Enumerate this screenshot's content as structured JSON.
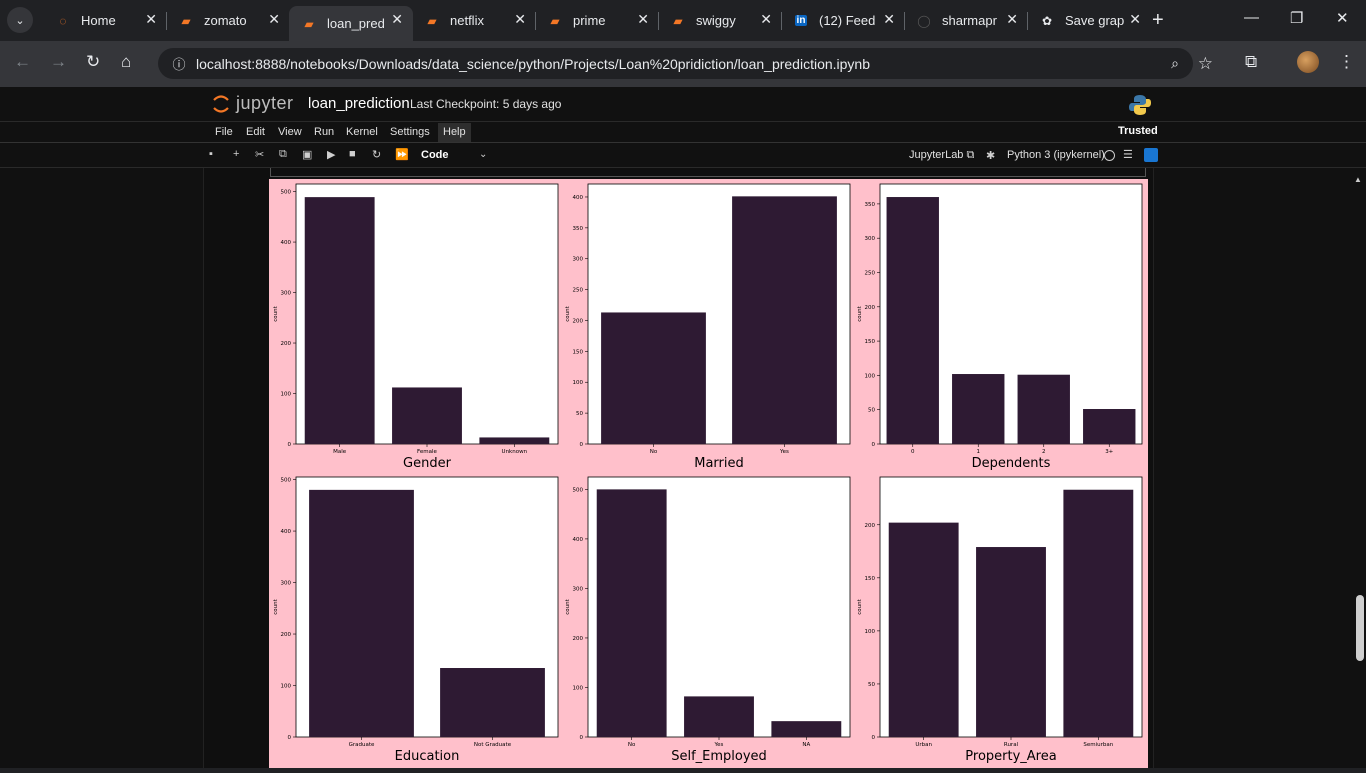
{
  "browser": {
    "tabs": [
      {
        "label": "Home",
        "icon": "jupyter-icon"
      },
      {
        "label": "zomato",
        "icon": "notebook-icon"
      },
      {
        "label": "loan_pred",
        "icon": "notebook-icon",
        "active": true
      },
      {
        "label": "netflix",
        "icon": "notebook-icon"
      },
      {
        "label": "prime",
        "icon": "notebook-icon"
      },
      {
        "label": "swiggy",
        "icon": "notebook-icon"
      },
      {
        "label": "(12) Feed",
        "icon": "linkedin-icon"
      },
      {
        "label": "sharmapr",
        "icon": "github-icon"
      },
      {
        "label": "Save grap",
        "icon": "chatgpt-icon"
      }
    ],
    "url": "localhost:8888/notebooks/Downloads/data_science/python/Projects/Loan%20pridiction/loan_prediction.ipynb"
  },
  "jupyter": {
    "brand": "jupyter",
    "notebook_name": "loan_prediction",
    "checkpoint": "Last Checkpoint: 5 days ago",
    "menu": [
      "File",
      "Edit",
      "View",
      "Run",
      "Kernel",
      "Settings",
      "Help"
    ],
    "trusted": "Trusted",
    "cell_type": "Code",
    "jupyterlab_label": "JupyterLab",
    "kernel_label": "Python 3 (ipykernel)"
  },
  "colors": {
    "figure_bg": "#ffc0cb",
    "bar": "#2e1a33",
    "accent": "#1976d2"
  },
  "chart_data": [
    {
      "type": "bar",
      "xlabel": "Gender",
      "ylabel": "count",
      "categories": [
        "Male",
        "Female",
        "Unknown"
      ],
      "values": [
        489,
        112,
        13
      ],
      "ylim": [
        0,
        515
      ],
      "yticks": [
        0,
        100,
        200,
        300,
        400,
        500
      ]
    },
    {
      "type": "bar",
      "xlabel": "Married",
      "ylabel": "count",
      "categories": [
        "No",
        "Yes"
      ],
      "values": [
        213,
        401
      ],
      "ylim": [
        0,
        421
      ],
      "yticks": [
        0,
        50,
        100,
        150,
        200,
        250,
        300,
        350,
        400
      ]
    },
    {
      "type": "bar",
      "xlabel": "Dependents",
      "ylabel": "count",
      "categories": [
        "0",
        "1",
        "2",
        "3+"
      ],
      "values": [
        360,
        102,
        101,
        51
      ],
      "ylim": [
        0,
        379
      ],
      "yticks": [
        0,
        50,
        100,
        150,
        200,
        250,
        300,
        350
      ]
    },
    {
      "type": "bar",
      "xlabel": "Education",
      "ylabel": "count",
      "categories": [
        "Graduate",
        "Not Graduate"
      ],
      "values": [
        480,
        134
      ],
      "ylim": [
        0,
        505
      ],
      "yticks": [
        0,
        100,
        200,
        300,
        400,
        500
      ]
    },
    {
      "type": "bar",
      "xlabel": "Self_Employed",
      "ylabel": "count",
      "categories": [
        "No",
        "Yes",
        "NA"
      ],
      "values": [
        500,
        82,
        32
      ],
      "ylim": [
        0,
        525
      ],
      "yticks": [
        0,
        100,
        200,
        300,
        400,
        500
      ]
    },
    {
      "type": "bar",
      "xlabel": "Property_Area",
      "ylabel": "count",
      "categories": [
        "Urban",
        "Rural",
        "Semiurban"
      ],
      "values": [
        202,
        179,
        233
      ],
      "ylim": [
        0,
        245
      ],
      "yticks": [
        0,
        50,
        100,
        150,
        200
      ]
    }
  ]
}
